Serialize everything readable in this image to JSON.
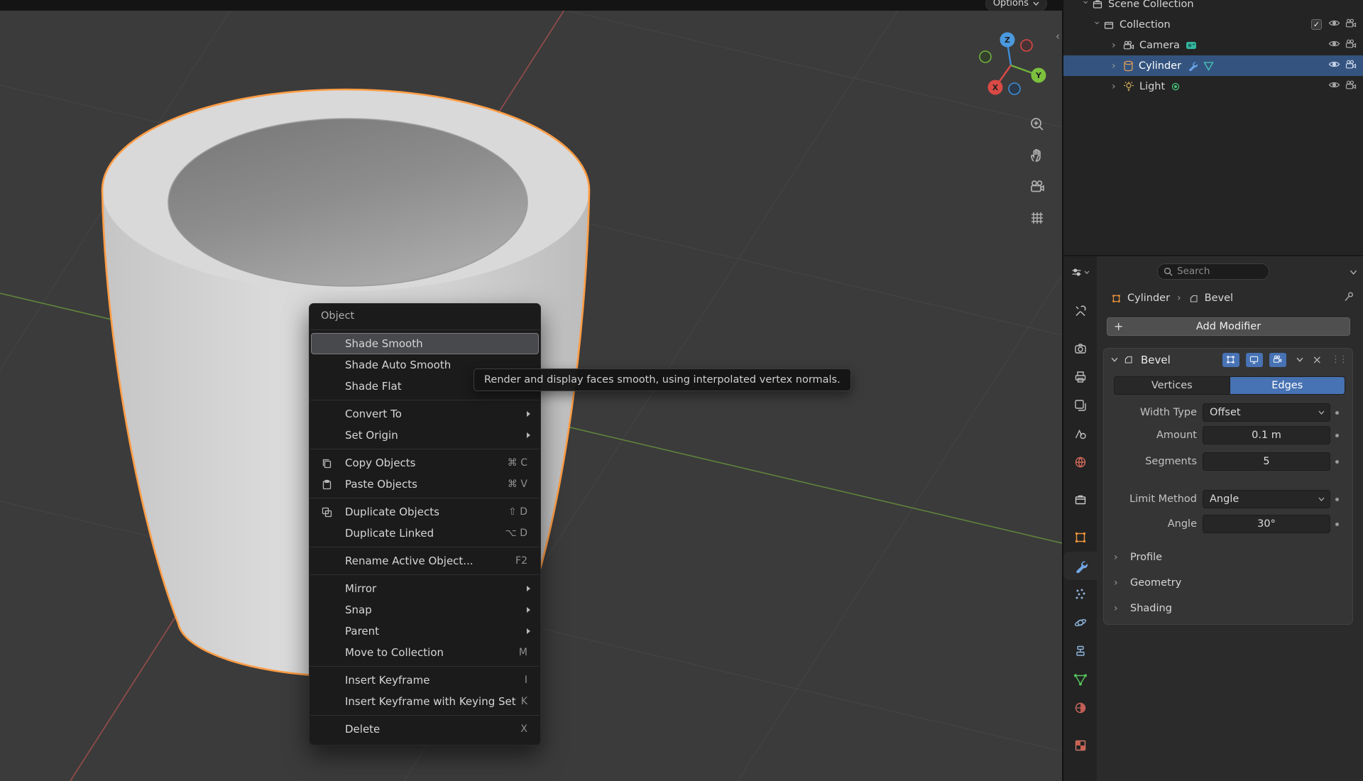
{
  "viewport": {
    "topbar": {
      "options_label": "Options"
    },
    "gizmo": {
      "axis_x": "X",
      "axis_y": "Y",
      "axis_z": "Z"
    },
    "tool_icons": [
      "zoom-icon",
      "pan-hand-icon",
      "camera-view-icon",
      "toggle-grid-icon"
    ]
  },
  "context_menu": {
    "title": "Object",
    "items": [
      {
        "label": "Shade Smooth",
        "highlighted": true
      },
      {
        "label": "Shade Auto Smooth"
      },
      {
        "label": "Shade Flat"
      },
      {
        "label": "Convert To",
        "submenu": true
      },
      {
        "label": "Set Origin",
        "submenu": true
      },
      {
        "label": "Copy Objects",
        "shortcut": "⌘ C",
        "icon": "copy-icon"
      },
      {
        "label": "Paste Objects",
        "shortcut": "⌘ V",
        "icon": "paste-icon"
      },
      {
        "label": "Duplicate Objects",
        "shortcut": "⇧ D",
        "icon": "duplicate-icon"
      },
      {
        "label": "Duplicate Linked",
        "shortcut": "⌥ D"
      },
      {
        "label": "Rename Active Object...",
        "shortcut": "F2"
      },
      {
        "label": "Mirror",
        "submenu": true
      },
      {
        "label": "Snap",
        "submenu": true
      },
      {
        "label": "Parent",
        "submenu": true
      },
      {
        "label": "Move to Collection",
        "shortcut": "M"
      },
      {
        "label": "Insert Keyframe",
        "shortcut": "I"
      },
      {
        "label": "Insert Keyframe with Keying Set",
        "shortcut": "K"
      },
      {
        "label": "Delete",
        "shortcut": "X"
      }
    ]
  },
  "tooltip": {
    "text": "Render and display faces smooth, using interpolated vertex normals."
  },
  "outliner": {
    "rows": [
      {
        "label": "Scene Collection",
        "icon": "scene-collection-icon"
      },
      {
        "label": "Collection",
        "icon": "collection-icon"
      },
      {
        "label": "Camera",
        "icon": "camera-object-icon"
      },
      {
        "label": "Cylinder",
        "icon": "mesh-cylinder-icon",
        "selected": true
      },
      {
        "label": "Light",
        "icon": "light-object-icon"
      }
    ]
  },
  "properties": {
    "search_placeholder": "Search",
    "breadcrumb": {
      "object": "Cylinder",
      "modifier": "Bevel"
    },
    "add_modifier_label": "Add Modifier",
    "rail_tabs": [
      "editor-type",
      "tool",
      "render",
      "output",
      "view-layer",
      "scene",
      "world",
      "collection",
      "object",
      "modifiers",
      "particles",
      "physics",
      "constraints",
      "object-data",
      "material",
      "texture"
    ],
    "rail_active_tab": "modifiers",
    "modifier": {
      "name": "Bevel",
      "affect_options": {
        "vertices": "Vertices",
        "edges": "Edges"
      },
      "affect_active": "Edges",
      "fields": {
        "width_type": {
          "label": "Width Type",
          "value": "Offset"
        },
        "amount": {
          "label": "Amount",
          "value": "0.1 m"
        },
        "segments": {
          "label": "Segments",
          "value": "5"
        },
        "limit_method": {
          "label": "Limit Method",
          "value": "Angle"
        },
        "angle": {
          "label": "Angle",
          "value": "30°"
        }
      },
      "sections": {
        "profile": "Profile",
        "geometry": "Geometry",
        "shading": "Shading"
      }
    }
  }
}
